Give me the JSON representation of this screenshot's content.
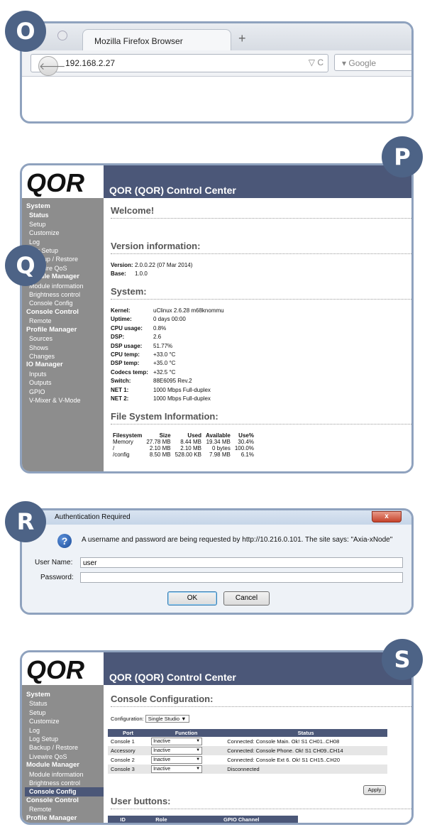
{
  "badges": {
    "o": "O",
    "p": "P",
    "q": "Q",
    "r": "R",
    "s": "S"
  },
  "browser": {
    "tab_title": "Mozilla Firefox Browser",
    "new_tab": "+",
    "back": "🡐",
    "url": "192.168.2.27",
    "url_icons": "▽ C",
    "search_placeholder": "▾ Google"
  },
  "control": {
    "logo": "QOR",
    "title": "QOR (QOR) Control Center"
  },
  "sidebar_p": [
    {
      "t": "System",
      "g": true
    },
    {
      "t": "Status",
      "active": true
    },
    {
      "t": "Setup"
    },
    {
      "t": "Customize"
    },
    {
      "t": "Log"
    },
    {
      "t": "Log Setup"
    },
    {
      "t": "Backup / Restore"
    },
    {
      "t": "Livewire QoS"
    },
    {
      "t": "Module Manager",
      "g": true
    },
    {
      "t": "Module information"
    },
    {
      "t": "Brightness control"
    },
    {
      "t": "Console Config"
    },
    {
      "t": "Console Control",
      "g": true
    },
    {
      "t": "Remote"
    },
    {
      "t": "Profile Manager",
      "g": true
    },
    {
      "t": "Sources"
    },
    {
      "t": "Shows"
    },
    {
      "t": "Changes"
    },
    {
      "t": "IO Manager",
      "g": true
    },
    {
      "t": "Inputs"
    },
    {
      "t": "Outputs"
    },
    {
      "t": "GPIO"
    },
    {
      "t": "V-Mixer & V-Mode"
    }
  ],
  "status": {
    "welcome": "Welcome!",
    "version_heading": "Version information:",
    "version_label": "Version:",
    "version_value": "2.0.0.22 (07 Mar 2014)",
    "base_label": "Base:",
    "base_value": "1.0.0",
    "system_heading": "System:",
    "system_rows": [
      {
        "k": "Kernel:",
        "v": "uClinux 2.6.28 m68knommu"
      },
      {
        "k": "Uptime:",
        "v": "0 days 00:00"
      },
      {
        "k": "CPU usage:",
        "v": "0.8%"
      },
      {
        "k": "DSP:",
        "v": "2.6"
      },
      {
        "k": "DSP usage:",
        "v": "51.77%"
      },
      {
        "k": "CPU temp:",
        "v": "+33.0 °C"
      },
      {
        "k": "DSP temp:",
        "v": "+35.0 °C"
      },
      {
        "k": "Codecs temp:",
        "v": "+32.5 °C"
      },
      {
        "k": "Switch:",
        "v": "88E6095 Rev.2"
      },
      {
        "k": "NET 1:",
        "v": "1000 Mbps Full-duplex"
      },
      {
        "k": "NET 2:",
        "v": "1000 Mbps Full-duplex"
      }
    ],
    "fs_heading": "File System Information:",
    "fs_columns": [
      "Filesystem",
      "Size",
      "Used",
      "Available",
      "Use%"
    ],
    "fs_rows": [
      [
        "Memory",
        "27.78 MB",
        "8.44 MB",
        "19.34 MB",
        "30.4%"
      ],
      [
        "/",
        "2.10 MB",
        "2.10 MB",
        "0 bytes",
        "100.0%"
      ],
      [
        "/config",
        "8.50 MB",
        "528.00 KB",
        "7.98 MB",
        "6.1%"
      ]
    ]
  },
  "auth": {
    "title": "Authentication Required",
    "close": "x",
    "message": "A username and password are being requested by http://10.216.0.101. The site says: \"Axia-xNode\"",
    "username_label": "User Name:",
    "username_value": "user",
    "password_label": "Password:",
    "ok": "OK",
    "cancel": "Cancel"
  },
  "sidebar_s": [
    {
      "t": "System",
      "g": true
    },
    {
      "t": "Status"
    },
    {
      "t": "Setup"
    },
    {
      "t": "Customize"
    },
    {
      "t": "Log"
    },
    {
      "t": "Log Setup"
    },
    {
      "t": "Backup / Restore"
    },
    {
      "t": "Livewire QoS"
    },
    {
      "t": "Module Manager",
      "g": true
    },
    {
      "t": "Module information"
    },
    {
      "t": "Brightness control"
    },
    {
      "t": "Console Config",
      "sel": true
    },
    {
      "t": "Console Control",
      "g": true
    },
    {
      "t": "Remote"
    },
    {
      "t": "Profile Manager",
      "g": true
    }
  ],
  "console": {
    "heading": "Console Configuration:",
    "config_label": "Configuration:",
    "config_value": "Single Studio",
    "columns": [
      "Port",
      "Function",
      "Status"
    ],
    "rows": [
      {
        "port": "Console 1",
        "fn": "Inactive",
        "status": "Connected: Console Main. Ok! S1 CH01..CH08"
      },
      {
        "port": "Accessory",
        "fn": "Inactive",
        "status": "Connected: Console Phone. Ok! S1 CH09..CH14"
      },
      {
        "port": "Console 2",
        "fn": "Inactive",
        "status": "Connected: Console Ext 6. Ok! S1 CH15..CH20"
      },
      {
        "port": "Console 3",
        "fn": "Inactive",
        "status": "Disconnected"
      }
    ],
    "apply": "Apply",
    "user_buttons_heading": "User buttons:",
    "ub_columns": [
      "ID",
      "Role",
      "GPIO Channel"
    ]
  }
}
